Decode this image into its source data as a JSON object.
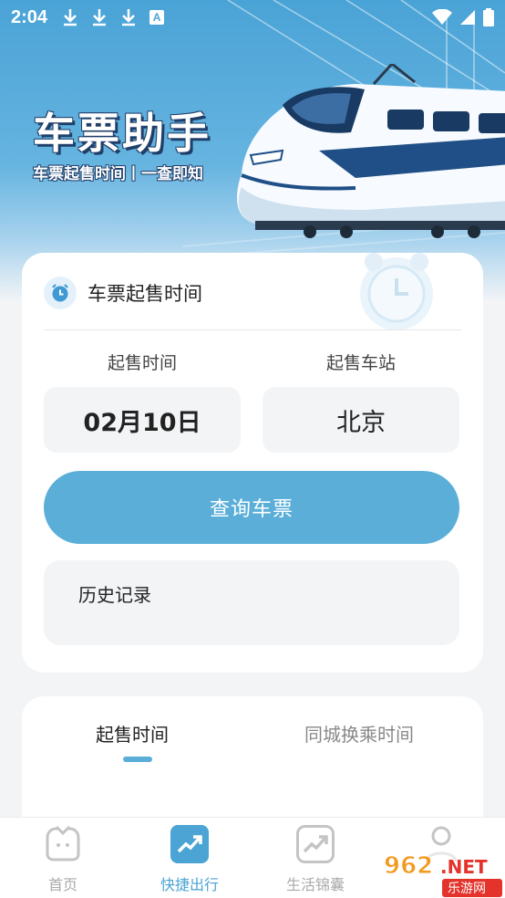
{
  "status_bar": {
    "time": "2:04",
    "badge": "A"
  },
  "hero": {
    "title": "车票助手",
    "subtitle": "车票起售时间丨一查即知"
  },
  "presale_card": {
    "title": "车票起售时间",
    "date_label": "起售时间",
    "date_value": "02月10日",
    "station_label": "起售车站",
    "station_value": "北京",
    "query_button": "查询车票",
    "history_label": "历史记录"
  },
  "tabs": [
    {
      "label": "起售时间",
      "active": true
    },
    {
      "label": "同城换乘时间",
      "active": false
    }
  ],
  "bottom_nav": [
    {
      "label": "首页",
      "icon": "home-icon",
      "active": false
    },
    {
      "label": "快捷出行",
      "icon": "trend-icon",
      "active": true
    },
    {
      "label": "生活锦囊",
      "icon": "trend-icon",
      "active": false
    },
    {
      "label": "",
      "icon": "profile-icon",
      "active": false
    }
  ],
  "watermark": {
    "logo": "962.NET",
    "caption": "乐游网"
  },
  "colors": {
    "accent": "#5aaed8",
    "hero_top": "#4aa3d6",
    "title_outline": "#1f3f6a",
    "inactive": "#aaaaaa"
  }
}
